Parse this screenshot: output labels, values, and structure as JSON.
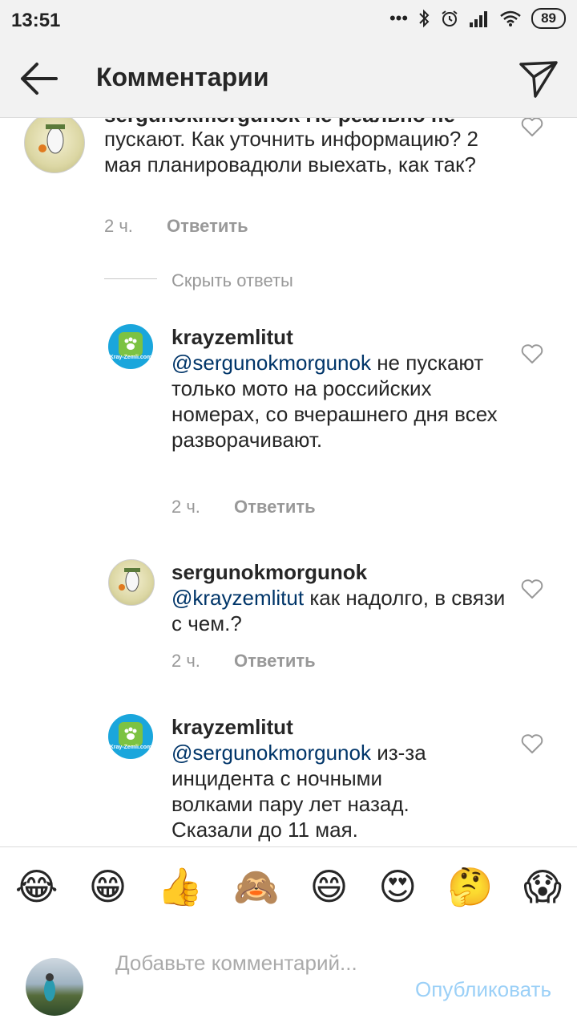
{
  "status_bar": {
    "time": "13:51",
    "signal_dots": "•••",
    "battery": "89"
  },
  "header": {
    "title": "Комментарии"
  },
  "comments": [
    {
      "username": "sergunokmorgunok",
      "text_cut": "sergunokmorgunok  Не реально не",
      "text": "пускают. Как уточнить информацию? 2 мая планировадюли выехать, как так?",
      "time": "2 ч.",
      "reply": "Ответить"
    },
    {
      "username": "krayzemlitut",
      "mention": "@sergunokmorgunok",
      "text": " не пускают только мото на российских номерах, со вчерашнего дня всех разворачивают.",
      "time": "2 ч.",
      "reply": "Ответить",
      "avatar_text": "Kray-Zemli.com"
    },
    {
      "username": "sergunokmorgunok",
      "mention": "@krayzemlitut",
      "text": " как надолго, в связи с чем.?",
      "time": "2 ч.",
      "reply": "Ответить"
    },
    {
      "username": "krayzemlitut",
      "mention": "@sergunokmorgunok",
      "text": " из-за инцидента с ночными волками пару лет назад. Сказали до 11 мая.",
      "avatar_text": "Kray-Zemli.com"
    }
  ],
  "hide_replies": "Скрыть ответы",
  "emojis": [
    "😂",
    "😁",
    "👍",
    "🙈",
    "😄",
    "😍",
    "🤔",
    "😱"
  ],
  "input": {
    "placeholder": "Добавьте комментарий...",
    "publish": "Опубликовать"
  },
  "colors": {
    "mention": "#003569",
    "publish_disabled": "#9bd0f7",
    "meta": "#999999"
  }
}
